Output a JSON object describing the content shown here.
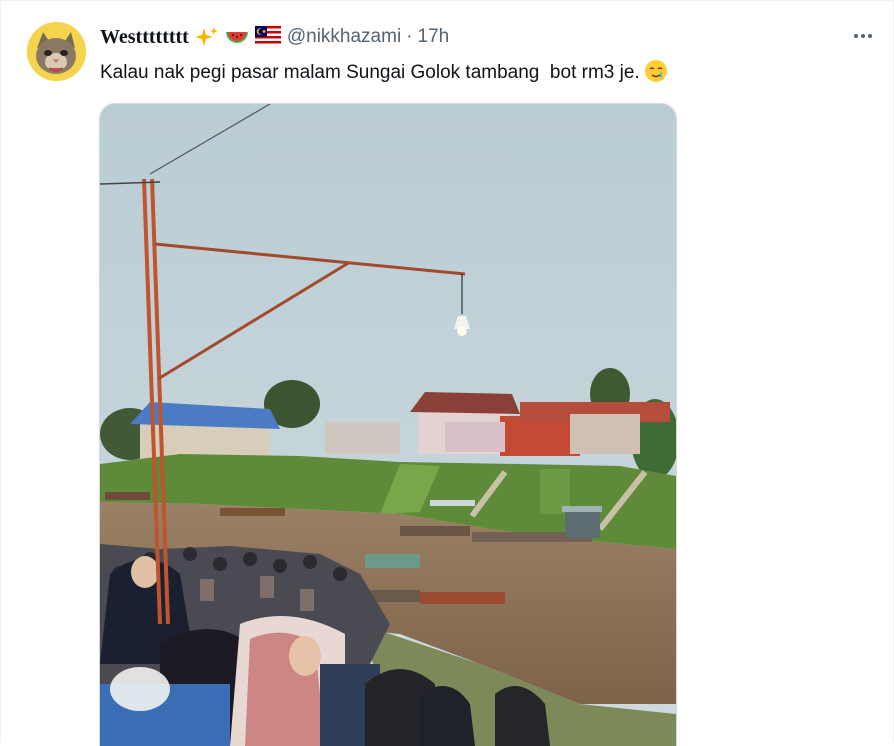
{
  "tweet": {
    "display_name": "Westttttttt",
    "name_emojis": [
      "sparkles-emoji",
      "watermelon-emoji",
      "malaysia-flag-emoji"
    ],
    "handle": "@nikkhazami",
    "separator": "·",
    "time": "17h",
    "text": "Kalau nak pegi pasar malam Sungai Golok tambang  bot rm3 je.",
    "text_emoji": "crying-smile-emoji",
    "more_icon": "more-horizontal-icon"
  },
  "media": {
    "description_icon": "photo",
    "scene": "river-ferry-crowd"
  },
  "colors": {
    "text": "#0f1419",
    "secondary": "#536471",
    "border": "#cfd9de",
    "sky": "#c8d6da",
    "river": "#8a7258",
    "grass": "#5f8a3a"
  }
}
